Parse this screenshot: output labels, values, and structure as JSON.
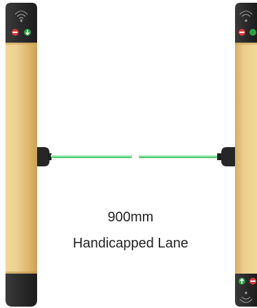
{
  "lane": {
    "width_text": "900mm",
    "type_text": "Handicapped Lane"
  },
  "colors": {
    "panel_gold": "#e8c47a",
    "cap_dark": "#2b2b2b",
    "beam_green": "#8fe8a8",
    "indicator_red": "#d93a3a",
    "indicator_green": "#2f9e44"
  },
  "icons": {
    "left_top_cap": [
      "nfc-icon",
      "no-entry-icon",
      "down-arrow-icon"
    ],
    "right_bottom_cap": [
      "up-arrow-icon",
      "no-entry-icon",
      "nfc-icon"
    ]
  }
}
